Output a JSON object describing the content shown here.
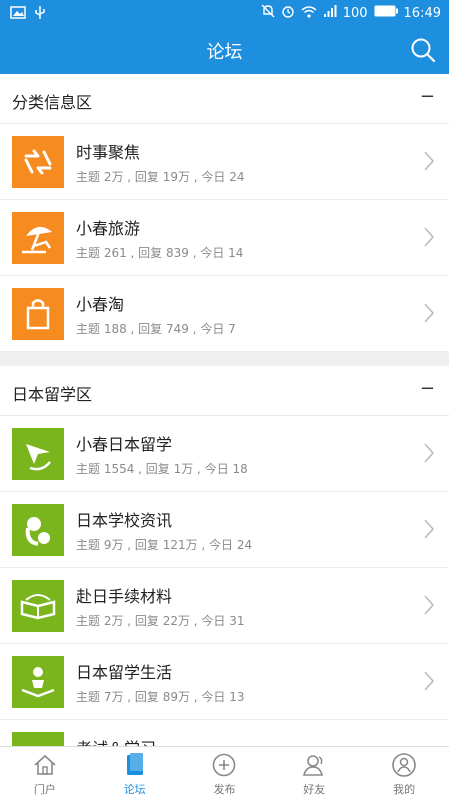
{
  "status_bar": {
    "battery": "100",
    "time": "16:49"
  },
  "header": {
    "title": "论坛"
  },
  "colors": {
    "accent": "#1e8fde",
    "orange": "#f68b1f",
    "green": "#7ab51d"
  },
  "sections": [
    {
      "title": "分类信息区",
      "collapse": "−",
      "items": [
        {
          "name": "时事聚焦",
          "stats": "主题 2万 , 回复 19万 , 今日 24",
          "icon": "swap-arrows-icon"
        },
        {
          "name": "小春旅游",
          "stats": "主题 261 , 回复 839 , 今日 14",
          "icon": "beach-umbrella-icon"
        },
        {
          "name": "小春淘",
          "stats": "主题 188 , 回复 749 , 今日 7",
          "icon": "shopping-bag-icon"
        }
      ]
    },
    {
      "title": "日本留学区",
      "collapse": "−",
      "items": [
        {
          "name": "小春日本留学",
          "stats": "主题 1554 , 回复 1万 , 今日 18",
          "icon": "paper-plane-icon"
        },
        {
          "name": "日本学校资讯",
          "stats": "主题 9万 , 回复 121万 , 今日 24",
          "icon": "quote-icon"
        },
        {
          "name": "赴日手续材料",
          "stats": "主题 2万 , 回复 22万 , 今日 31",
          "icon": "open-book-icon"
        },
        {
          "name": "日本留学生活",
          "stats": "主题 7万 , 回复 89万 , 今日 13",
          "icon": "reader-icon"
        },
        {
          "name": "考试＆学习",
          "stats": "",
          "icon": "study-icon"
        }
      ]
    }
  ],
  "tabbar": [
    {
      "label": "门户",
      "icon": "home-icon",
      "active": false
    },
    {
      "label": "论坛",
      "icon": "forum-icon",
      "active": true
    },
    {
      "label": "发布",
      "icon": "plus-circle-icon",
      "active": false
    },
    {
      "label": "好友",
      "icon": "friends-icon",
      "active": false
    },
    {
      "label": "我的",
      "icon": "profile-icon",
      "active": false
    }
  ]
}
